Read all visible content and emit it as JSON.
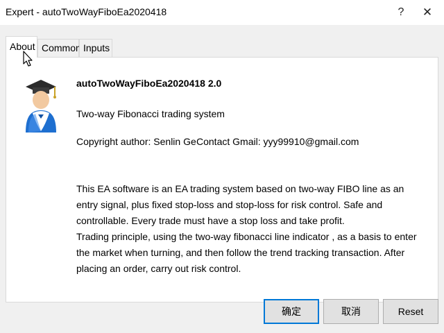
{
  "window": {
    "title": "Expert - autoTwoWayFiboEa2020418",
    "help_glyph": "?",
    "close_glyph": "✕"
  },
  "tabs": [
    {
      "label": "About",
      "active": true
    },
    {
      "label": "Common",
      "active": false
    },
    {
      "label": "Inputs",
      "active": false
    }
  ],
  "about": {
    "avatar_icon": "graduate-user-icon",
    "name": "autoTwoWayFiboEa2020418 2.0",
    "description": "Two-way Fibonacci trading system",
    "copyright": "Copyright author:  Senlin Ge",
    "contact": "Contact Gmail: yyy99910@gmail.com",
    "paragraph1": "This EA software is an EA trading system based on two-way FIBO line as an entry signal, plus fixed stop-loss and stop-loss for risk control. Safe and controllable. Every trade must have a stop loss and take profit.",
    "paragraph2": "Trading principle, using the two-way fibonacci line indicator , as a basis to enter the market when turning, and then follow the trend tracking transaction. After placing an order, carry out risk control."
  },
  "buttons": {
    "ok": "确定",
    "cancel": "取消",
    "reset": "Reset"
  },
  "colors": {
    "window_bg": "#f0f0f0",
    "panel_bg": "#ffffff",
    "button_bg": "#e1e1e1",
    "focus_border": "#0078d7",
    "avatar_blue": "#1e6fd0"
  }
}
